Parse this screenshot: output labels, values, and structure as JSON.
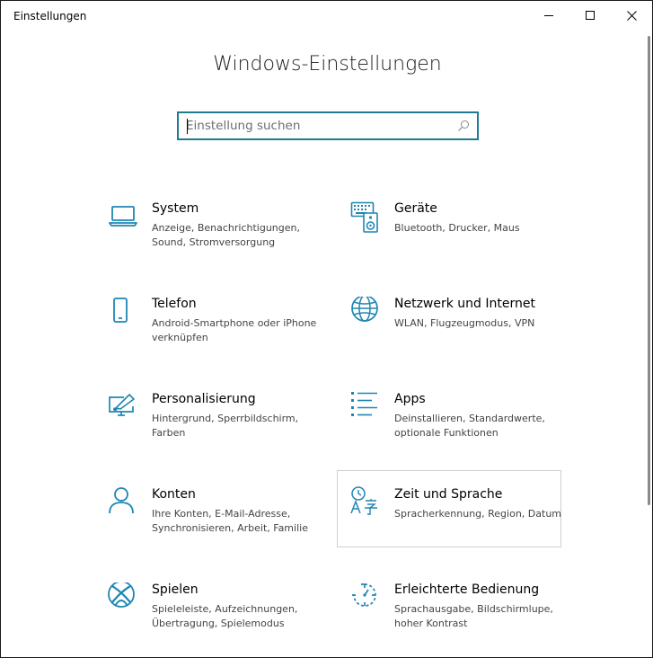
{
  "window": {
    "title": "Einstellungen"
  },
  "header": {
    "title": "Windows-Einstellungen"
  },
  "search": {
    "placeholder": "Einstellung suchen",
    "value": ""
  },
  "colors": {
    "accent": "#1f86b3",
    "search_border": "#1f7a94"
  },
  "tiles": [
    {
      "title": "System",
      "description": "Anzeige, Benachrichtigungen, Sound, Stromversorgung",
      "icon": "laptop-icon"
    },
    {
      "title": "Geräte",
      "description": "Bluetooth, Drucker, Maus",
      "icon": "devices-icon"
    },
    {
      "title": "Telefon",
      "description": "Android-Smartphone oder iPhone verknüpfen",
      "icon": "phone-icon"
    },
    {
      "title": "Netzwerk und Internet",
      "description": "WLAN, Flugzeugmodus, VPN",
      "icon": "globe-icon"
    },
    {
      "title": "Personalisierung",
      "description": "Hintergrund, Sperrbildschirm, Farben",
      "icon": "paint-brush-icon"
    },
    {
      "title": "Apps",
      "description": "Deinstallieren, Standardwerte, optionale Funktionen",
      "icon": "apps-list-icon"
    },
    {
      "title": "Konten",
      "description": "Ihre Konten, E-Mail-Adresse, Synchronisieren, Arbeit, Familie",
      "icon": "person-icon"
    },
    {
      "title": "Zeit und Sprache",
      "description": "Spracherkennung, Region, Datum",
      "icon": "time-language-icon"
    },
    {
      "title": "Spielen",
      "description": "Spieleleiste, Aufzeichnungen, Übertragung, Spielemodus",
      "icon": "xbox-icon"
    },
    {
      "title": "Erleichterte Bedienung",
      "description": "Sprachausgabe, Bildschirmlupe, hoher Kontrast",
      "icon": "ease-of-access-icon"
    }
  ]
}
